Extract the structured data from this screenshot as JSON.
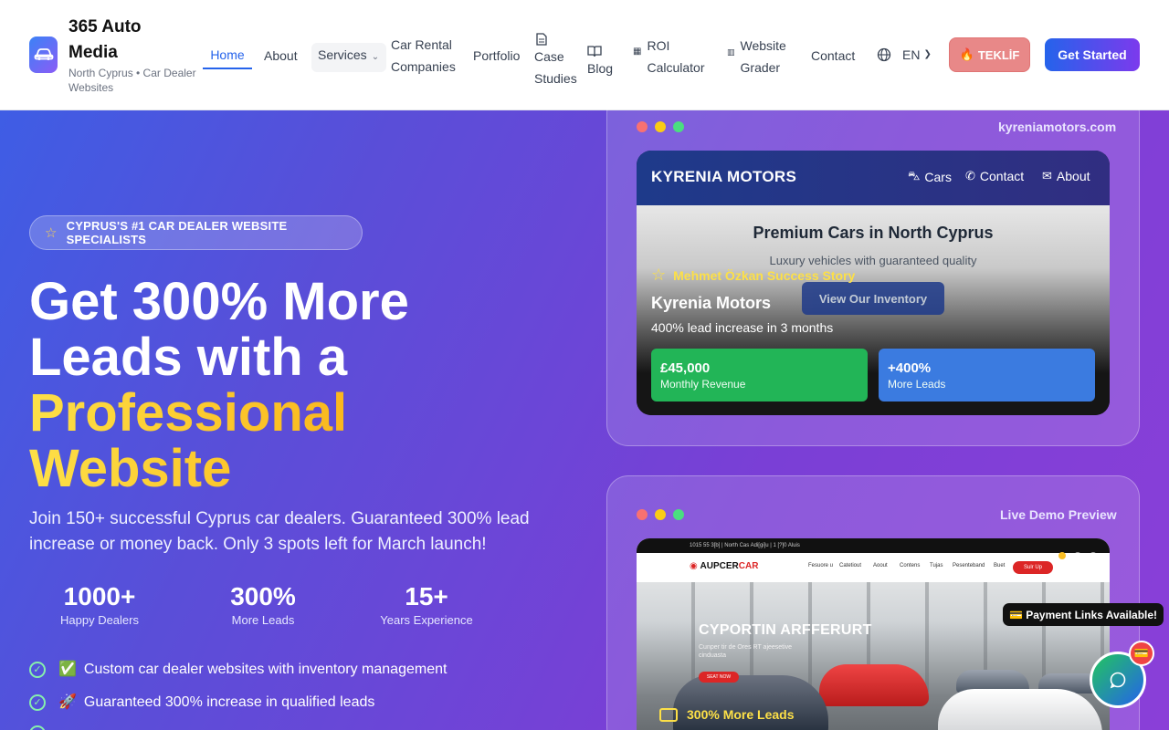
{
  "header": {
    "brand_name": "365 Auto Media",
    "brand_tagline": "North Cyprus • Car Dealer Websites",
    "nav": {
      "home": "Home",
      "about": "About",
      "services": "Services",
      "car_rental": "Car Rental Companies",
      "portfolio": "Portfolio",
      "case_studies": "Case Studies",
      "blog": "Blog",
      "roi_calculator": "ROI Calculator",
      "website_grader": "Website Grader",
      "contact": "Contact"
    },
    "language": "EN",
    "teklif_label": "TEKLİF",
    "get_started_label": "Get Started"
  },
  "hero": {
    "badge": "CYPRUS'S #1 CAR DEALER WEBSITE SPECIALISTS",
    "title_line1": "Get 300% More",
    "title_line2": "Leads with a",
    "title_highlight1": "Professional",
    "title_highlight2": "Website",
    "subtitle": "Join 150+ successful Cyprus car dealers. Guaranteed 300% lead increase or money back. Only 3 spots left for March launch!",
    "stats": [
      {
        "value": "1000+",
        "label": "Happy Dealers"
      },
      {
        "value": "300%",
        "label": "More Leads"
      },
      {
        "value": "15+",
        "label": "Years Experience"
      }
    ],
    "features": [
      {
        "emoji": "✅",
        "text": "Custom car dealer websites with inventory management"
      },
      {
        "emoji": "🚀",
        "text": "Guaranteed 300% increase in qualified leads"
      }
    ]
  },
  "showcase": {
    "url": "kyreniamotors.com",
    "site_brand": "KYRENIA MOTORS",
    "site_nav": [
      "Cars",
      "Contact",
      "About"
    ],
    "site_headline": "Premium Cars in North Cyprus",
    "site_subheadline": "Luxury vehicles with guaranteed quality",
    "site_button": "View Our Inventory",
    "story_label": "Mehmet Özkan Success Story",
    "client_name": "Kyrenia Motors",
    "client_result": "400% lead increase in 3 months",
    "metrics": [
      {
        "value": "£45,000",
        "label": "Monthly Revenue",
        "color": "#22b557"
      },
      {
        "value": "+400%",
        "label": "More Leads",
        "color": "#3b7be0"
      }
    ]
  },
  "demo": {
    "label": "Live Demo Preview",
    "topbar": "1015 55 3[b] | North Cas Adi[gi]u | 1 [?]0 Aluis",
    "logo_prefix": "AUPCER",
    "logo_suffix": "CAR",
    "nav": [
      "Fesuore u",
      "Catetiout",
      "Aoout",
      "Contens",
      "Tujas",
      "Pesenteband",
      "Buet"
    ],
    "signup": "Sulr Up",
    "headline": "CYPORTIN ARFFERURT",
    "paragraph": "Cunper tir de Ores RT ajeesetive cinduasta",
    "button": "SEAT NOW",
    "leads_label": "300% More Leads"
  },
  "floating": {
    "payment_tip": "💳 Payment Links Available!",
    "chat_badge": "💳"
  },
  "colors": {
    "accent": "#2563eb",
    "teklif": "#e88888",
    "highlight": "#fbbf24"
  }
}
